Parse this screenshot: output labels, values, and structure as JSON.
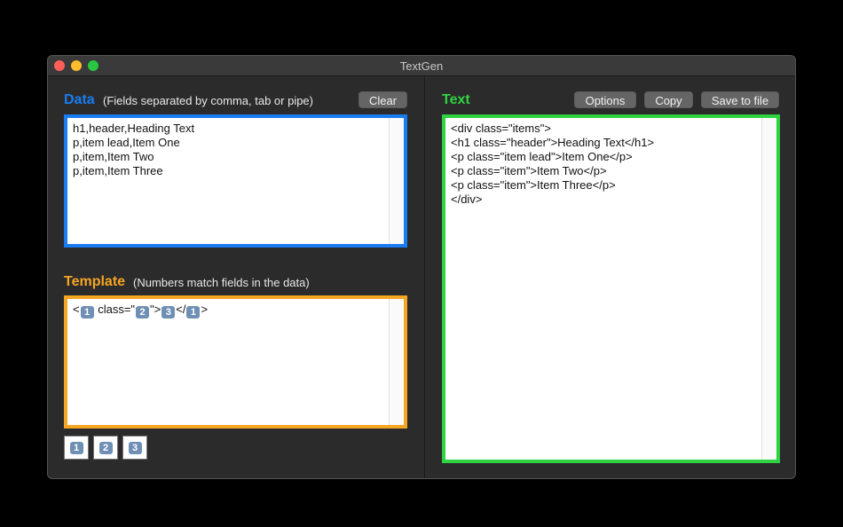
{
  "window": {
    "title": "TextGen"
  },
  "data_panel": {
    "title": "Data",
    "subtitle": "(Fields separated by comma, tab or pipe)",
    "clear_label": "Clear",
    "lines": [
      "h1,header,Heading Text",
      "p,item lead,Item One",
      "p,item,Item Two",
      "p,item,Item Three"
    ]
  },
  "template_panel": {
    "title": "Template",
    "subtitle": "(Numbers match fields in the data)",
    "template_parts": [
      "<",
      "1",
      " class=\"",
      "2",
      "\">",
      "3",
      "</",
      "1",
      ">"
    ],
    "field_buttons": [
      "1",
      "2",
      "3"
    ]
  },
  "text_panel": {
    "title": "Text",
    "options_label": "Options",
    "copy_label": "Copy",
    "save_label": "Save to file",
    "lines": [
      "<div class=\"items\">",
      "<h1 class=\"header\">Heading Text</h1>",
      "<p class=\"item lead\">Item One</p>",
      "<p class=\"item\">Item Two</p>",
      "<p class=\"item\">Item Three</p>",
      "</div>"
    ]
  },
  "colors": {
    "data_accent": "#1a7cf2",
    "template_accent": "#f5a623",
    "text_accent": "#2fd341",
    "keycap": "#6f8fb4"
  }
}
